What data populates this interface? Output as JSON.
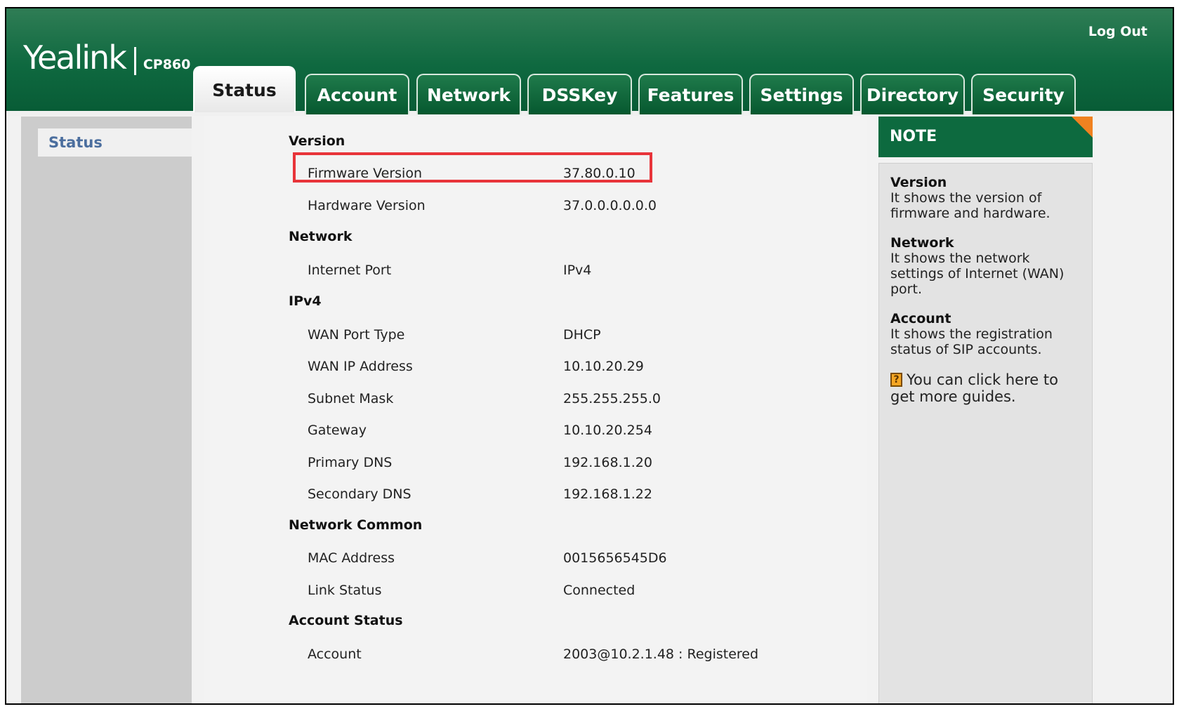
{
  "header": {
    "brand": "Yealink",
    "model": "CP860",
    "logout": "Log Out",
    "tabs": [
      {
        "label": "Status",
        "active": true
      },
      {
        "label": "Account"
      },
      {
        "label": "Network"
      },
      {
        "label": "DSSKey"
      },
      {
        "label": "Features"
      },
      {
        "label": "Settings"
      },
      {
        "label": "Directory"
      },
      {
        "label": "Security"
      }
    ]
  },
  "sidebar": {
    "items": [
      {
        "label": "Status"
      }
    ]
  },
  "status": {
    "version": {
      "title": "Version",
      "firmware_label": "Firmware Version",
      "firmware_value": "37.80.0.10",
      "hardware_label": "Hardware Version",
      "hardware_value": "37.0.0.0.0.0.0"
    },
    "network": {
      "title": "Network",
      "internet_port_label": "Internet Port",
      "internet_port_value": "IPv4"
    },
    "ipv4": {
      "title": "IPv4",
      "wan_type_label": "WAN Port Type",
      "wan_type_value": "DHCP",
      "wan_ip_label": "WAN IP Address",
      "wan_ip_value": "10.10.20.29",
      "subnet_label": "Subnet Mask",
      "subnet_value": "255.255.255.0",
      "gateway_label": "Gateway",
      "gateway_value": "10.10.20.254",
      "primary_dns_label": "Primary DNS",
      "primary_dns_value": "192.168.1.20",
      "secondary_dns_label": "Secondary DNS",
      "secondary_dns_value": "192.168.1.22"
    },
    "network_common": {
      "title": "Network Common",
      "mac_label": "MAC Address",
      "mac_value": "0015656545D6",
      "link_label": "Link Status",
      "link_value": "Connected"
    },
    "account_status": {
      "title": "Account Status",
      "account_label": "Account",
      "account_value": "2003@10.2.1.48 : Registered"
    }
  },
  "note": {
    "title": "NOTE",
    "sections": [
      {
        "title": "Version",
        "text": "It shows the version of firmware and hardware."
      },
      {
        "title": "Network",
        "text": "It shows the network settings of Internet (WAN) port."
      },
      {
        "title": "Account",
        "text": "It shows the registration status of SIP accounts."
      }
    ],
    "guide": "You can click here to get more guides.",
    "guide_icon": "help-book-icon",
    "accent_color": "#f08220"
  },
  "colors": {
    "header_green": "#0f6940",
    "highlight_red": "#e8343a",
    "sidebar_link": "#4b6e9e"
  }
}
